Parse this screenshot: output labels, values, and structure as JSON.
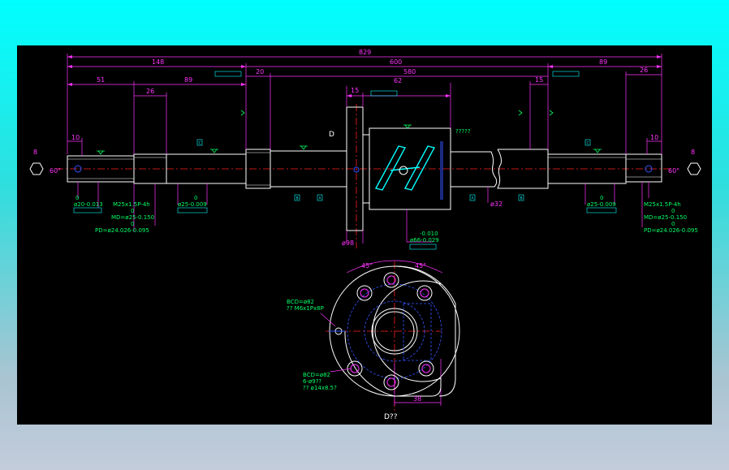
{
  "dimensions": {
    "overall": "829",
    "left_end": "148",
    "thread_len": "600",
    "right_end": "89",
    "left_51": "51",
    "left_26": "26",
    "left_89": "89",
    "left_20": "20",
    "shaft_580": "580",
    "nut_15": "15",
    "nut_62": "62",
    "right_15": "15",
    "right_26": "26",
    "left_10": "10",
    "right_10": "10",
    "hex_left": "8",
    "hex_right": "8",
    "angle_left": "60°",
    "angle_right": "60°",
    "flange_dia": "ø98",
    "shaft_dia": "ø32",
    "angle_a": "45°",
    "angle_b": "45°",
    "flange_38": "38"
  },
  "labels": {
    "d_marker": "D",
    "nut_note": "?????",
    "left_journal_zero": "0",
    "left_journal": "ø20-0.013",
    "left_thread": "M25x1.5P-4h",
    "left_md_zero": "0",
    "left_md": "MD=ø25-0.150",
    "left_pd_zero": "0",
    "left_pd": "PD=ø24.026-0.095",
    "left_bearing_zero": "0",
    "left_bearing": "ø25-0.009",
    "right_bearing_zero": "0",
    "right_bearing": "ø25-0.009",
    "right_thread": "M25x1.5P-4h",
    "right_md_zero": "0",
    "right_md": "MD=ø25-0.150",
    "right_pd_zero": "0",
    "right_pd": "PD=ø24.026-0.095",
    "nut_tol_top": "-0.010",
    "nut_tol": "ø66-0.029",
    "bcd1": "BCD=ø82",
    "oil_hole": "?? M6x1Px8P",
    "bcd2": "BCD=ø82",
    "bolt_holes": "6-ø9??",
    "counterbore": "?? ø14x8.5?",
    "section_title": "D??"
  },
  "datums": {
    "a": "A",
    "b": "B",
    "c": "C"
  },
  "colors": {
    "magenta": "#ff33ff",
    "green": "#00ff66",
    "cyan": "#00ffff",
    "blue": "#3355ff",
    "red": "#ff2020",
    "white": "#ffffff"
  }
}
